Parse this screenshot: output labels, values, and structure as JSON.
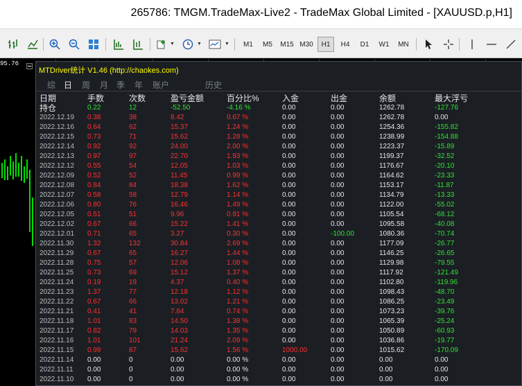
{
  "window": {
    "title": "265786: TMGM.TradeMax-Live2 - TradeMax Global Limited - [XAUUSD.p,H1]"
  },
  "toolbar": {
    "periods": [
      "M1",
      "M5",
      "M15",
      "M30",
      "H1",
      "H4",
      "D1",
      "W1",
      "MN"
    ],
    "active_period": "H1"
  },
  "chart": {
    "price_tag": "95.76"
  },
  "panel": {
    "title": "MTDriver统计 V1.46  (http://chaokes.com)",
    "tabs": [
      "综",
      "日",
      "周",
      "月",
      "季",
      "年",
      "账户",
      "历史"
    ],
    "active_tab": "日",
    "headers": {
      "date": "日期",
      "lots": "手数",
      "count": "次数",
      "pl": "盈亏金额",
      "pct": "百分比%",
      "deposit": "入金",
      "withdraw": "出金",
      "balance": "余额",
      "max_dd": "最大浮亏"
    },
    "position_row": {
      "label": "持仓",
      "lots": "0.22",
      "count": "12",
      "pl": "-52.50",
      "pct": "-4.16 %",
      "deposit": "0.00",
      "withdraw": "0.00",
      "balance": "1262.78",
      "max_dd": "-127.76"
    },
    "rows": [
      {
        "date": "2022.12.19",
        "lots": "0.38",
        "count": "38",
        "pl": "8.42",
        "pct": "0.67 %",
        "deposit": "0.00",
        "withdraw": "0.00",
        "balance": "1262.78",
        "max_dd": "0.00"
      },
      {
        "date": "2022.12.16",
        "lots": "0.64",
        "count": "62",
        "pl": "15.37",
        "pct": "1.24 %",
        "deposit": "0.00",
        "withdraw": "0.00",
        "balance": "1254.36",
        "max_dd": "-155.82"
      },
      {
        "date": "2022.12.15",
        "lots": "0.73",
        "count": "71",
        "pl": "15.62",
        "pct": "1.28 %",
        "deposit": "0.00",
        "withdraw": "0.00",
        "balance": "1238.99",
        "max_dd": "-154.88"
      },
      {
        "date": "2022.12.14",
        "lots": "0.92",
        "count": "92",
        "pl": "24.00",
        "pct": "2.00 %",
        "deposit": "0.00",
        "withdraw": "0.00",
        "balance": "1223.37",
        "max_dd": "-15.89"
      },
      {
        "date": "2022.12.13",
        "lots": "0.97",
        "count": "97",
        "pl": "22.70",
        "pct": "1.93 %",
        "deposit": "0.00",
        "withdraw": "0.00",
        "balance": "1199.37",
        "max_dd": "-32.52"
      },
      {
        "date": "2022.12.12",
        "lots": "0.55",
        "count": "54",
        "pl": "12.05",
        "pct": "1.03 %",
        "deposit": "0.00",
        "withdraw": "0.00",
        "balance": "1176.67",
        "max_dd": "-20.10"
      },
      {
        "date": "2022.12.09",
        "lots": "0.52",
        "count": "52",
        "pl": "11.45",
        "pct": "0.99 %",
        "deposit": "0.00",
        "withdraw": "0.00",
        "balance": "1164.62",
        "max_dd": "-23.33"
      },
      {
        "date": "2022.12.08",
        "lots": "0.84",
        "count": "84",
        "pl": "18.38",
        "pct": "1.62 %",
        "deposit": "0.00",
        "withdraw": "0.00",
        "balance": "1153.17",
        "max_dd": "-11.87"
      },
      {
        "date": "2022.12.07",
        "lots": "0.58",
        "count": "58",
        "pl": "12.79",
        "pct": "1.14 %",
        "deposit": "0.00",
        "withdraw": "0.00",
        "balance": "1134.79",
        "max_dd": "-13.33"
      },
      {
        "date": "2022.12.06",
        "lots": "0.80",
        "count": "76",
        "pl": "16.46",
        "pct": "1.49 %",
        "deposit": "0.00",
        "withdraw": "0.00",
        "balance": "1122.00",
        "max_dd": "-55.02"
      },
      {
        "date": "2022.12.05",
        "lots": "0.51",
        "count": "51",
        "pl": "9.96",
        "pct": "0.91 %",
        "deposit": "0.00",
        "withdraw": "0.00",
        "balance": "1105.54",
        "max_dd": "-68.12"
      },
      {
        "date": "2022.12.02",
        "lots": "0.67",
        "count": "66",
        "pl": "15.22",
        "pct": "1.41 %",
        "deposit": "0.00",
        "withdraw": "0.00",
        "balance": "1095.58",
        "max_dd": "-40.08"
      },
      {
        "date": "2022.12.01",
        "lots": "0.71",
        "count": "65",
        "pl": "3.27",
        "pct": "0.30 %",
        "deposit": "0.00",
        "withdraw": "-100.00",
        "balance": "1080.36",
        "max_dd": "-70.74"
      },
      {
        "date": "2022.11.30",
        "lots": "1.32",
        "count": "132",
        "pl": "30.84",
        "pct": "2.69 %",
        "deposit": "0.00",
        "withdraw": "0.00",
        "balance": "1177.09",
        "max_dd": "-26.77"
      },
      {
        "date": "2022.11.29",
        "lots": "0.67",
        "count": "65",
        "pl": "16.27",
        "pct": "1.44 %",
        "deposit": "0.00",
        "withdraw": "0.00",
        "balance": "1146.25",
        "max_dd": "-26.65"
      },
      {
        "date": "2022.11.28",
        "lots": "0.75",
        "count": "57",
        "pl": "12.06",
        "pct": "1.08 %",
        "deposit": "0.00",
        "withdraw": "0.00",
        "balance": "1129.98",
        "max_dd": "-79.55"
      },
      {
        "date": "2022.11.25",
        "lots": "0.73",
        "count": "69",
        "pl": "15.12",
        "pct": "1.37 %",
        "deposit": "0.00",
        "withdraw": "0.00",
        "balance": "1117.92",
        "max_dd": "-121.49"
      },
      {
        "date": "2022.11.24",
        "lots": "0.19",
        "count": "19",
        "pl": "4.37",
        "pct": "0.40 %",
        "deposit": "0.00",
        "withdraw": "0.00",
        "balance": "1102.80",
        "max_dd": "-119.96"
      },
      {
        "date": "2022.11.23",
        "lots": "1.37",
        "count": "77",
        "pl": "12.18",
        "pct": "1.12 %",
        "deposit": "0.00",
        "withdraw": "0.00",
        "balance": "1098.43",
        "max_dd": "-48.70"
      },
      {
        "date": "2022.11.22",
        "lots": "0.67",
        "count": "66",
        "pl": "13.02",
        "pct": "1.21 %",
        "deposit": "0.00",
        "withdraw": "0.00",
        "balance": "1086.25",
        "max_dd": "-23.49"
      },
      {
        "date": "2022.11.21",
        "lots": "0.41",
        "count": "41",
        "pl": "7.84",
        "pct": "0.74 %",
        "deposit": "0.00",
        "withdraw": "0.00",
        "balance": "1073.23",
        "max_dd": "-39.76"
      },
      {
        "date": "2022.11.18",
        "lots": "1.01",
        "count": "83",
        "pl": "14.50",
        "pct": "1.38 %",
        "deposit": "0.00",
        "withdraw": "0.00",
        "balance": "1065.39",
        "max_dd": "-25.24"
      },
      {
        "date": "2022.11.17",
        "lots": "0.82",
        "count": "79",
        "pl": "14.03",
        "pct": "1.35 %",
        "deposit": "0.00",
        "withdraw": "0.00",
        "balance": "1050.89",
        "max_dd": "-60.93"
      },
      {
        "date": "2022.11.16",
        "lots": "1.01",
        "count": "101",
        "pl": "21.24",
        "pct": "2.09 %",
        "deposit": "0.00",
        "withdraw": "0.00",
        "balance": "1036.86",
        "max_dd": "-19.77"
      },
      {
        "date": "2022.11.15",
        "lots": "0.99",
        "count": "87",
        "pl": "15.62",
        "pct": "1.56 %",
        "deposit": "1000.00",
        "withdraw": "0.00",
        "balance": "1015.62",
        "max_dd": "-170.09"
      },
      {
        "date": "2022.11.14",
        "lots": "0.00",
        "count": "0",
        "pl": "0.00",
        "pct": "0.00 %",
        "deposit": "0.00",
        "withdraw": "0.00",
        "balance": "0.00",
        "max_dd": "0.00"
      },
      {
        "date": "2022.11.11",
        "lots": "0.00",
        "count": "0",
        "pl": "0.00",
        "pct": "0.00 %",
        "deposit": "0.00",
        "withdraw": "0.00",
        "balance": "0.00",
        "max_dd": "0.00"
      },
      {
        "date": "2022.11.10",
        "lots": "0.00",
        "count": "0",
        "pl": "0.00",
        "pct": "0.00 %",
        "deposit": "0.00",
        "withdraw": "0.00",
        "balance": "0.00",
        "max_dd": "0.00"
      }
    ]
  },
  "colors": {
    "profit": "#ff2f2f",
    "positive": "#33e033",
    "neutral": "#e6e6e6",
    "title": "#ffff00"
  }
}
